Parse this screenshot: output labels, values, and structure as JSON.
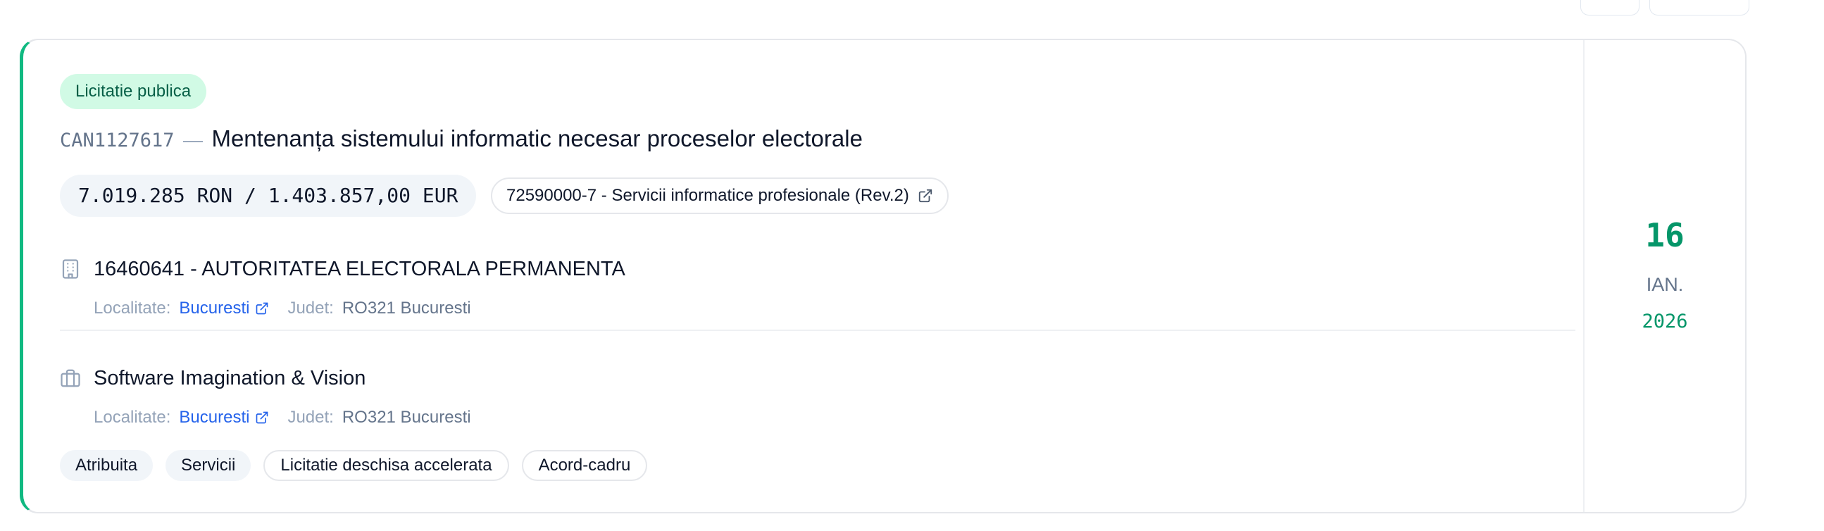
{
  "card": {
    "procedure_badge": "Licitatie publica",
    "announcement_code": "CAN1127617",
    "separator": "—",
    "title": "Mentenanța sistemului informatic necesar proceselor electorale",
    "value": "7.019.285 RON / 1.403.857,00 EUR",
    "cpv": "72590000-7 - Servicii informatice profesionale (Rev.2)",
    "authority": {
      "name": "16460641 - AUTORITATEA ELECTORALA PERMANENTA",
      "locality_label": "Localitate:",
      "locality": "Bucuresti",
      "county_label": "Judet:",
      "county": "RO321 Bucuresti"
    },
    "supplier": {
      "name": "Software Imagination & Vision",
      "locality_label": "Localitate:",
      "locality": "Bucuresti",
      "county_label": "Judet:",
      "county": "RO321 Bucuresti"
    },
    "tags": [
      {
        "label": "Atribuita",
        "style": "filled"
      },
      {
        "label": "Servicii",
        "style": "filled"
      },
      {
        "label": "Licitatie deschisa accelerata",
        "style": "outline"
      },
      {
        "label": "Acord-cadru",
        "style": "outline"
      }
    ],
    "date": {
      "day": "16",
      "month": "IAN.",
      "year": "2026"
    }
  },
  "colors": {
    "accent": "#10b981",
    "accent_dark": "#059669",
    "badge_bg": "#d1fae5",
    "badge_text": "#065f46",
    "link": "#2563eb"
  },
  "icons": {
    "authority": "building-icon",
    "supplier": "briefcase-icon",
    "external": "external-link-icon"
  }
}
